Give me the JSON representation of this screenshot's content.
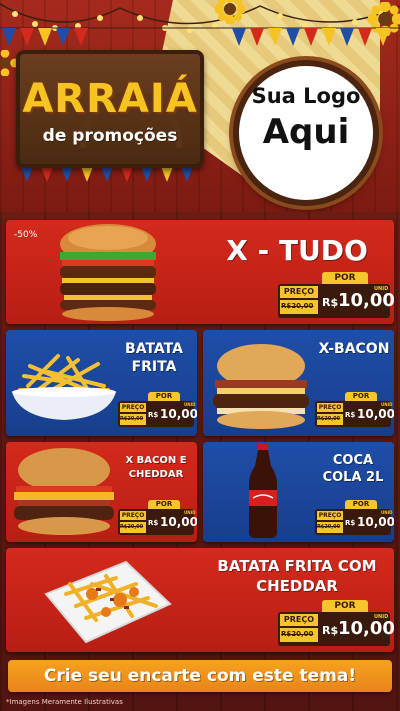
{
  "header": {
    "sign_title": "ARRAIÁ",
    "sign_subtitle": "de promoções",
    "logo_line1": "Sua Logo",
    "logo_line2": "Aqui"
  },
  "products": [
    {
      "title": "X - TUDO",
      "discount": "-50%",
      "por": "POR",
      "preco": "PREÇO",
      "old_price": "R$20,00",
      "currency": "R$",
      "price": "10,00",
      "unit": "UNID"
    },
    {
      "title": "BATATA FRITA",
      "por": "POR",
      "preco": "PREÇO",
      "old_price": "R$20,00",
      "currency": "R$",
      "price": "10,00",
      "unit": "UNID"
    },
    {
      "title": "X-BACON",
      "por": "POR",
      "preco": "PREÇO",
      "old_price": "R$20,00",
      "currency": "R$",
      "price": "10,00",
      "unit": "UNID"
    },
    {
      "title": "X BACON E CHEDDAR",
      "por": "POR",
      "preco": "PREÇO",
      "old_price": "R$20,00",
      "currency": "R$",
      "price": "10,00",
      "unit": "UNID"
    },
    {
      "title": "COCA COLA 2L",
      "por": "POR",
      "preco": "PREÇO",
      "old_price": "R$20,00",
      "currency": "R$",
      "price": "10,00",
      "unit": "UNID"
    },
    {
      "title": "BATATA FRITA COM CHEDDAR",
      "por": "POR",
      "preco": "PREÇO",
      "old_price": "R$20,00",
      "currency": "R$",
      "price": "10,00",
      "unit": "UNID"
    }
  ],
  "cta": "Crie seu encarte com este tema!",
  "footnote": "*Imagens Meramente Ilustrativas",
  "colors": {
    "red_card": "#c8241a",
    "blue_card": "#1b469c",
    "yellow": "#f6c52c",
    "cta": "#f0931c"
  }
}
